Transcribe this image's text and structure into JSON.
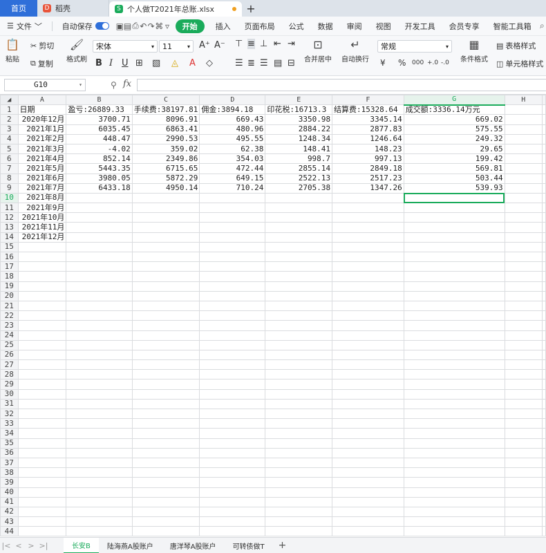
{
  "tabs": {
    "home": "首页",
    "doc1": "稻壳",
    "doc2": "个人做T2021年总账.xlsx"
  },
  "menu": {
    "file": "文件",
    "autosave": "自动保存",
    "start": "开始",
    "items": [
      "插入",
      "页面布局",
      "公式",
      "数据",
      "审阅",
      "视图",
      "开发工具",
      "会员专享",
      "智能工具箱"
    ]
  },
  "ribbon": {
    "paste": "粘贴",
    "cut": "剪切",
    "copy": "复制",
    "format_painter": "格式刷",
    "font_name": "宋体",
    "font_size": "11",
    "merge_center": "合并居中",
    "wrap_text": "自动换行",
    "number_format": "常规",
    "cond_format": "条件格式",
    "table_style": "表格样式",
    "cell_style": "单元格样式"
  },
  "formula_bar": {
    "cell_ref": "G10",
    "fx": "fx",
    "value": ""
  },
  "sheet": {
    "columns": [
      "A",
      "B",
      "C",
      "D",
      "E",
      "F",
      "G",
      "H"
    ],
    "selected_col": "G",
    "selected_row": 10,
    "rows": [
      [
        "日期",
        "盈亏:26889.33",
        "手续费:38197.81",
        "佣金:3894.18",
        "印花税:16713.3",
        "结算费:15328.64",
        "成交额:3336.14万元",
        ""
      ],
      [
        "2020年12月",
        "3700.71",
        "8096.91",
        "669.43",
        "3350.98",
        "3345.14",
        "669.02",
        ""
      ],
      [
        "2021年1月",
        "6035.45",
        "6863.41",
        "480.96",
        "2884.22",
        "2877.83",
        "575.55",
        ""
      ],
      [
        "2021年2月",
        "448.47",
        "2990.53",
        "495.55",
        "1248.34",
        "1246.64",
        "249.32",
        ""
      ],
      [
        "2021年3月",
        "-4.02",
        "359.02",
        "62.38",
        "148.41",
        "148.23",
        "29.65",
        ""
      ],
      [
        "2021年4月",
        "852.14",
        "2349.86",
        "354.03",
        "998.7",
        "997.13",
        "199.42",
        ""
      ],
      [
        "2021年5月",
        "5443.35",
        "6715.65",
        "472.44",
        "2855.14",
        "2849.18",
        "569.81",
        ""
      ],
      [
        "2021年6月",
        "3980.05",
        "5872.29",
        "649.15",
        "2522.13",
        "2517.23",
        "503.44",
        ""
      ],
      [
        "2021年7月",
        "6433.18",
        "4950.14",
        "710.24",
        "2705.38",
        "1347.26",
        "539.93",
        ""
      ],
      [
        "2021年8月",
        "",
        "",
        "",
        "",
        "",
        "",
        ""
      ],
      [
        "2021年9月",
        "",
        "",
        "",
        "",
        "",
        "",
        ""
      ],
      [
        "2021年10月",
        "",
        "",
        "",
        "",
        "",
        "",
        ""
      ],
      [
        "2021年11月",
        "",
        "",
        "",
        "",
        "",
        "",
        ""
      ],
      [
        "2021年12月",
        "",
        "",
        "",
        "",
        "",
        "",
        ""
      ]
    ],
    "total_rows": 44
  },
  "sheet_tabs": [
    "长安B",
    "陆海燕A股账户",
    "唐洋琴A股账户",
    "可转债做T"
  ],
  "active_sheet": "长安B",
  "colors": {
    "accent": "#1aab5b",
    "home_tab": "#2f6fd9"
  }
}
